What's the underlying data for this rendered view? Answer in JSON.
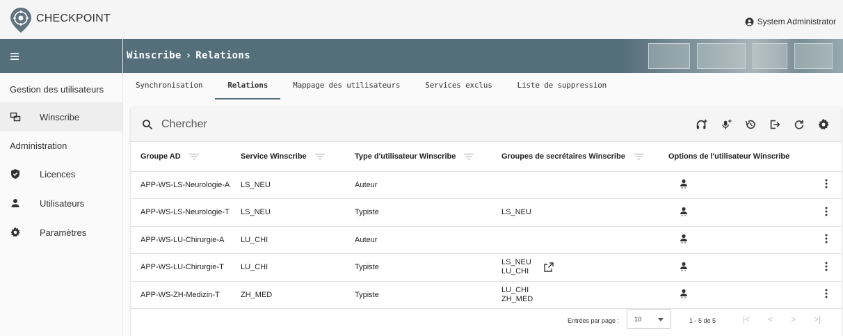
{
  "app": {
    "brand": "CHECKPOINT",
    "user": "System Administrator"
  },
  "breadcrumb": {
    "parent": "Winscribe",
    "separator": "›",
    "current": "Relations"
  },
  "sidebar": {
    "sections": [
      {
        "title": "Gestion des utilisateurs"
      },
      {
        "title": "Administration"
      }
    ],
    "items": [
      {
        "label": "Winscribe",
        "icon": "windows-icon"
      },
      {
        "label": "Licences",
        "icon": "shield-icon"
      },
      {
        "label": "Utilisateurs",
        "icon": "person-icon"
      },
      {
        "label": "Paramètres",
        "icon": "gear-icon"
      }
    ]
  },
  "tabs": [
    {
      "label": "Synchronisation"
    },
    {
      "label": "Relations"
    },
    {
      "label": "Mappage des utilisateurs"
    },
    {
      "label": "Services exclus"
    },
    {
      "label": "Liste de suppression"
    }
  ],
  "search": {
    "placeholder": "Chercher"
  },
  "table": {
    "headers": [
      "Groupe AD",
      "Service Winscribe",
      "Type d'utilisateur Winscribe",
      "Groupes de secrétaires Winscribe",
      "Options de l'utilisateur Winscribe"
    ],
    "rows": [
      {
        "group": "APP-WS-LS-Neurologie-A",
        "service": "LS_NEU",
        "type": "Auteur",
        "sec1": "",
        "sec2": ""
      },
      {
        "group": "APP-WS-LS-Neurologie-T",
        "service": "LS_NEU",
        "type": "Typiste",
        "sec1": "LS_NEU",
        "sec2": ""
      },
      {
        "group": "APP-WS-LU-Chirurgie-A",
        "service": "LU_CHI",
        "type": "Auteur",
        "sec1": "",
        "sec2": ""
      },
      {
        "group": "APP-WS-LU-Chirurgie-T",
        "service": "LU_CHI",
        "type": "Typiste",
        "sec1": "LS_NEU",
        "sec2": "LU_CHI"
      },
      {
        "group": "APP-WS-ZH-Medizin-T",
        "service": "ZH_MED",
        "type": "Typiste",
        "sec1": "LU_CHI",
        "sec2": "ZH_MED"
      }
    ]
  },
  "pager": {
    "label": "Entrées par page :",
    "page_size": "10",
    "range": "1 - 5 de 5"
  },
  "colors": {
    "primary": "#546e7a",
    "logo": "#5f7480"
  }
}
